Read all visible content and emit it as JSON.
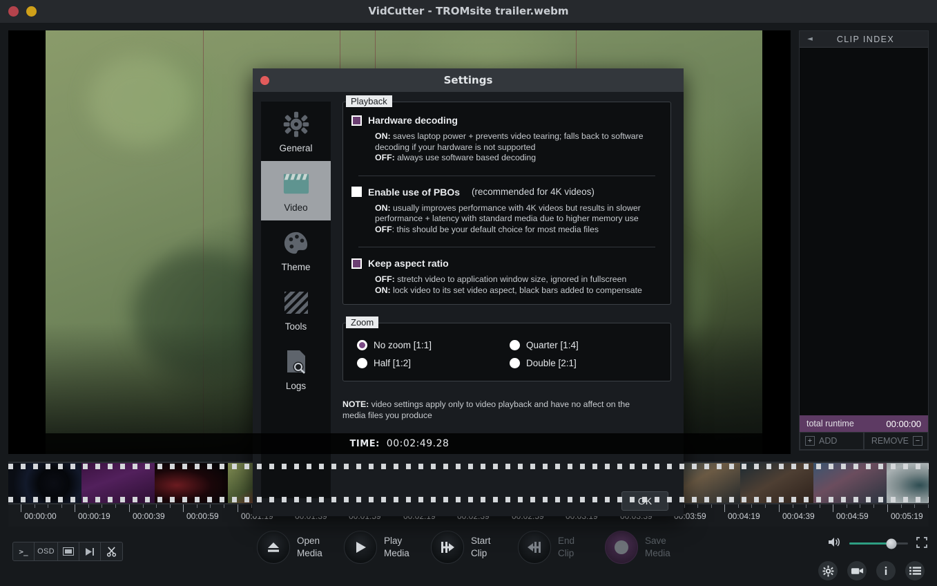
{
  "window": {
    "title": "VidCutter - TROMsite trailer.webm",
    "dots": [
      "close",
      "minimize"
    ]
  },
  "video": {
    "time_label": "TIME:",
    "time_value": "00:02:49.28"
  },
  "clip_index": {
    "collapse_icon": "left-triangle-icon",
    "title": "CLIP INDEX",
    "runtime_label": "total runtime",
    "runtime_value": "00:00:00",
    "add_label": "ADD",
    "add_icon": "plus-icon",
    "remove_label": "REMOVE",
    "remove_icon": "minus-icon"
  },
  "ruler": {
    "labels": [
      "00:00:00",
      "00:00:19",
      "00:00:39",
      "00:00:59",
      "00:01:19",
      "00:01:39",
      "00:01:59",
      "00:02:19",
      "00:02:39",
      "00:02:59",
      "00:03:19",
      "00:03:39",
      "00:03:59",
      "00:04:19",
      "00:04:39",
      "00:04:59",
      "00:05:19"
    ]
  },
  "toolbar": {
    "mini_buttons": [
      {
        "name": "console-icon",
        "label": ">_"
      },
      {
        "name": "osd-icon",
        "label": "OSD"
      },
      {
        "name": "thumbnail-icon",
        "label": ""
      },
      {
        "name": "frame-step-icon",
        "label": ""
      },
      {
        "name": "scissors-icon",
        "label": ""
      }
    ],
    "actions": [
      {
        "name": "open-media",
        "icon": "eject-icon",
        "line1": "Open",
        "line2": "Media",
        "disabled": false
      },
      {
        "name": "play-media",
        "icon": "play-icon",
        "line1": "Play",
        "line2": "Media",
        "disabled": false
      },
      {
        "name": "start-clip",
        "icon": "clip-start-icon",
        "line1": "Start",
        "line2": "Clip",
        "disabled": false
      },
      {
        "name": "end-clip",
        "icon": "clip-end-icon",
        "line1": "End",
        "line2": "Clip",
        "disabled": true
      },
      {
        "name": "save-media",
        "icon": "record-icon",
        "line1": "Save",
        "line2": "Media",
        "disabled": true
      }
    ],
    "volume_icon": "speaker-icon",
    "volume_percent": 72,
    "fullscreen_icon": "fullscreen-icon",
    "round_icons": [
      "gear-icon",
      "camera-icon",
      "info-icon",
      "list-icon"
    ]
  },
  "settings_dialog": {
    "title": "Settings",
    "close_icon": "close-dot-icon",
    "nav": [
      {
        "label": "General",
        "icon": "gear-icon",
        "active": false
      },
      {
        "label": "Video",
        "icon": "clapperboard-icon",
        "active": true
      },
      {
        "label": "Theme",
        "icon": "palette-icon",
        "active": false
      },
      {
        "label": "Tools",
        "icon": "tools-icon",
        "active": false
      },
      {
        "label": "Logs",
        "icon": "log-search-icon",
        "active": false
      }
    ],
    "playback": {
      "legend": "Playback",
      "options": [
        {
          "label": "Hardware decoding",
          "extra": "",
          "checked": true,
          "desc": [
            {
              "strong": "ON:",
              "text": " saves laptop power + prevents video tearing; falls back to software decoding if your hardware is not supported"
            },
            {
              "strong": "OFF:",
              "text": " always use software based decoding"
            }
          ]
        },
        {
          "label": "Enable use of PBOs",
          "extra": "(recommended for 4K videos)",
          "checked": false,
          "desc": [
            {
              "strong": "ON:",
              "text": " usually improves performance with 4K videos but results in slower performance + latency with standard media due to higher memory use"
            },
            {
              "strong": "OFF",
              "text": ": this should be your default choice for most media files"
            }
          ]
        },
        {
          "label": "Keep aspect ratio",
          "extra": "",
          "checked": true,
          "desc": [
            {
              "strong": "OFF:",
              "text": " stretch video to application window size, ignored in fullscreen"
            },
            {
              "strong": "ON:",
              "text": " lock video to its set video aspect, black bars added to compensate"
            }
          ]
        }
      ]
    },
    "zoom": {
      "legend": "Zoom",
      "options": [
        {
          "label": "No zoom [1:1]",
          "selected": true
        },
        {
          "label": "Quarter [1:4]",
          "selected": false
        },
        {
          "label": "Half [1:2]",
          "selected": false
        },
        {
          "label": "Double [2:1]",
          "selected": false
        }
      ]
    },
    "note": {
      "strong": "NOTE:",
      "text": " video settings apply only to video playback and have no affect on the media files you produce"
    },
    "ok_label": "OK"
  },
  "colors": {
    "accent_purple": "#6b3f72",
    "runtime_bar": "#5d3a63",
    "volume_fill": "#2e9e82",
    "nav_active": "#9ea2a6"
  }
}
